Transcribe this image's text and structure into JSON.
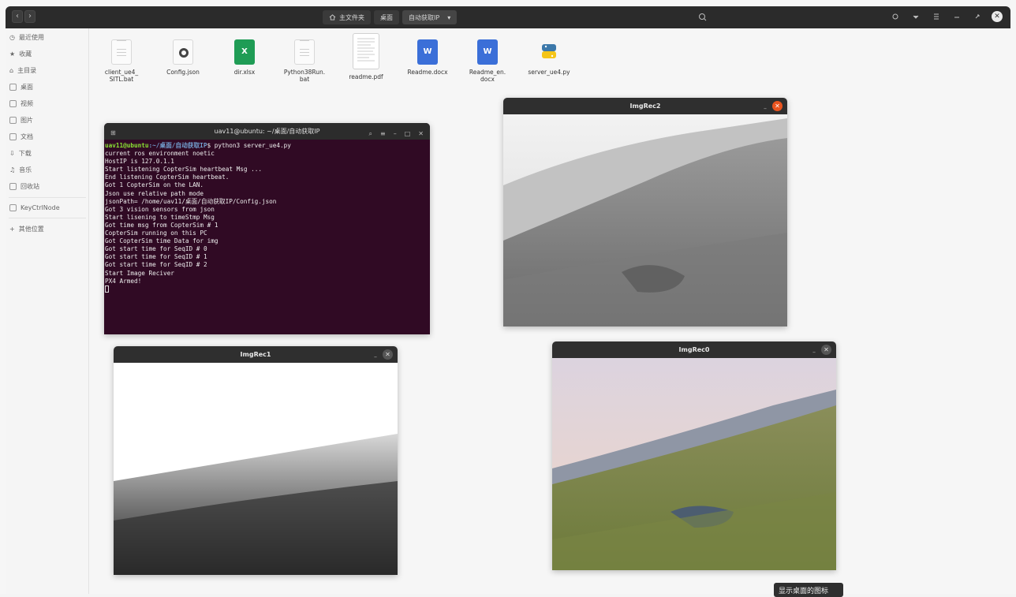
{
  "header": {
    "crumbs": [
      {
        "label": "主文件夹",
        "icon": "home-icon"
      },
      {
        "label": "桌面"
      },
      {
        "label": "自动获取IP",
        "dropdown": "▾"
      }
    ],
    "right_icons": [
      "view-icon",
      "menu-icon",
      "minimize-icon",
      "maximize-icon"
    ],
    "close": "✕",
    "nav_back": "‹",
    "nav_forward": "›"
  },
  "sidebar": {
    "items": [
      {
        "label": "最近使用",
        "icon": "clock-icon"
      },
      {
        "label": "收藏",
        "icon": "star-icon"
      },
      {
        "label": "主目录",
        "icon": "home-icon"
      },
      {
        "label": "桌面",
        "icon": "desktop-icon"
      },
      {
        "label": "视频",
        "icon": "video-icon"
      },
      {
        "label": "图片",
        "icon": "image-icon"
      },
      {
        "label": "文档",
        "icon": "document-icon"
      },
      {
        "label": "下载",
        "icon": "download-icon"
      },
      {
        "label": "音乐",
        "icon": "music-icon"
      },
      {
        "label": "回收站",
        "icon": "trash-icon"
      },
      {
        "label": "KeyCtrlNode",
        "icon": "drive-icon"
      },
      {
        "label": "其他位置",
        "icon": "plus-icon"
      }
    ]
  },
  "files": [
    {
      "name": "client_ue4_\nSITL.bat",
      "type": "doc"
    },
    {
      "name": "Config.json",
      "type": "json"
    },
    {
      "name": "dir.xlsx",
      "type": "xls"
    },
    {
      "name": "Python38Run.\nbat",
      "type": "doc"
    },
    {
      "name": "readme.pdf",
      "type": "pdf"
    },
    {
      "name": "Readme.docx",
      "type": "word"
    },
    {
      "name": "Readme_en.\ndocx",
      "type": "word"
    },
    {
      "name": "server_ue4.py",
      "type": "py"
    }
  ],
  "terminal": {
    "title": "uav11@ubuntu: ~/桌面/自动获取IP",
    "prompt_user": "uav11@ubuntu",
    "prompt_path": ":~/桌面/自动获取IP",
    "command": "$ python3 server_ue4.py",
    "lines": [
      "current ros environment noetic",
      "HostIP is 127.0.1.1",
      "Start listening CopterSim heartbeat Msg ...",
      "End listening CopterSim heartbeat.",
      "Got 1 CopterSim on the LAN.",
      "Json use relative path mode",
      "jsonPath= /home/uav11/桌面/自动获取IP/Config.json",
      "Got 3 vision sensors from json",
      "Start lisening to timeStmp Msg",
      "Got time msg from CopterSim # 1",
      "CopterSim running on this PC",
      "Got CopterSim time Data for img",
      "Got start time for SeqID # 0",
      "Got start time for SeqID # 1",
      "Got start time for SeqID # 2",
      "Start Image Reciver",
      "PX4 Armed!"
    ]
  },
  "windows": {
    "img2_title": "ImgRec2",
    "img1_title": "ImgRec1",
    "img0_title": "ImgRec0",
    "close": "✕",
    "minimize": "–"
  },
  "tooltip": "显示桌面的图标"
}
